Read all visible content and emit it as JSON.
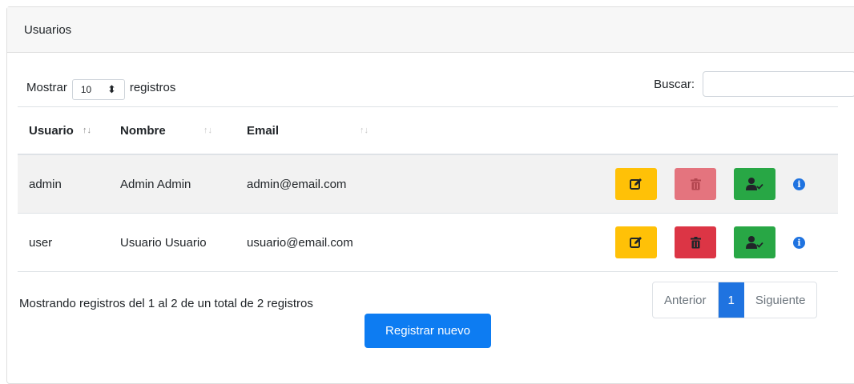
{
  "card": {
    "title": "Usuarios"
  },
  "length": {
    "prefix": "Mostrar",
    "value": "10",
    "suffix": "registros"
  },
  "search": {
    "label": "Buscar:",
    "value": ""
  },
  "columns": [
    {
      "label": "Usuario"
    },
    {
      "label": "Nombre"
    },
    {
      "label": "Email"
    }
  ],
  "rows": [
    {
      "usuario": "admin",
      "nombre": "Admin Admin",
      "email": "admin@email.com"
    },
    {
      "usuario": "user",
      "nombre": "Usuario Usuario",
      "email": "usuario@email.com"
    }
  ],
  "summary": "Mostrando registros del 1 al 2 de un total de 2 registros",
  "pagination": {
    "prev": "Anterior",
    "current": "1",
    "next": "Siguiente"
  },
  "new_button": "Registrar nuevo",
  "icons": {
    "edit": "edit-icon",
    "delete": "trash-icon",
    "user": "user-check-icon",
    "info": "info-icon",
    "sort": "sort-arrows-icon"
  },
  "colors": {
    "edit": "#ffc107",
    "delete": "#dc3545",
    "user": "#28a745",
    "primary": "#0d7cf2"
  }
}
